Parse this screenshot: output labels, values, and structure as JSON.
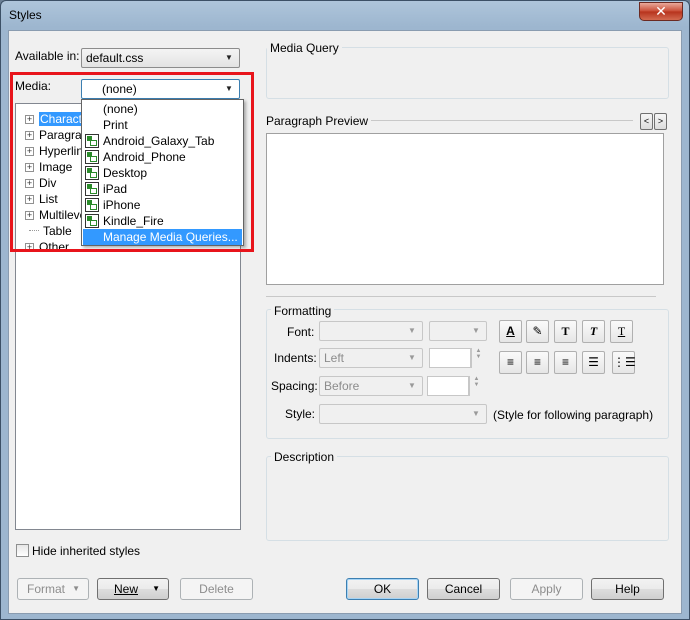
{
  "window": {
    "title": "Styles",
    "close_glyph": "✕"
  },
  "left": {
    "available_label": "Available in:",
    "available_value": "default.css",
    "media_label": "Media:",
    "media_value": "(none)",
    "tree": [
      {
        "label": "Characte",
        "expandable": true,
        "selected": true
      },
      {
        "label": "Paragrap",
        "expandable": true
      },
      {
        "label": "Hyperlink",
        "expandable": true
      },
      {
        "label": "Image",
        "expandable": true
      },
      {
        "label": "Div",
        "expandable": true
      },
      {
        "label": "List",
        "expandable": true
      },
      {
        "label": "Multileve",
        "expandable": true
      },
      {
        "label": "Table",
        "expandable": false
      },
      {
        "label": "Other",
        "expandable": true
      }
    ],
    "media_options": [
      {
        "label": "(none)",
        "icon": "none"
      },
      {
        "label": "Print",
        "icon": "none"
      },
      {
        "label": "Android_Galaxy_Tab",
        "icon": "device-icon"
      },
      {
        "label": "Android_Phone",
        "icon": "device-icon"
      },
      {
        "label": "Desktop",
        "icon": "device-icon"
      },
      {
        "label": "iPad",
        "icon": "device-icon"
      },
      {
        "label": "iPhone",
        "icon": "device-icon"
      },
      {
        "label": "Kindle_Fire",
        "icon": "device-icon"
      },
      {
        "label": "Manage Media Queries...",
        "icon": "none",
        "highlighted": true
      }
    ],
    "hide_inherited_label": "Hide inherited styles"
  },
  "right": {
    "media_query_title": "Media Query",
    "preview_title": "Paragraph Preview",
    "prev_glyph": "<",
    "next_glyph": ">",
    "formatting_title": "Formatting",
    "font_label": "Font:",
    "indents_label": "Indents:",
    "indents_value": "Left",
    "spacing_label": "Spacing:",
    "spacing_value": "Before",
    "style_label": "Style:",
    "style_note": "(Style for following paragraph)",
    "description_title": "Description"
  },
  "buttons": {
    "format": "Format",
    "new": "New",
    "delete": "Delete",
    "ok": "OK",
    "cancel": "Cancel",
    "apply": "Apply",
    "help": "Help"
  },
  "colors": {
    "highlight_box": "#e8141b",
    "selection": "#3399ff"
  }
}
